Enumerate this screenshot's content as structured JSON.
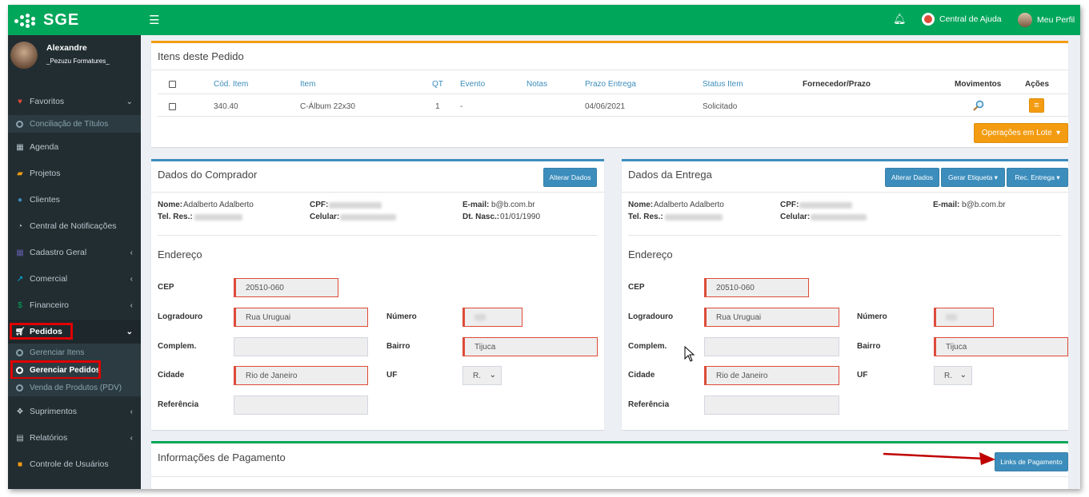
{
  "app": {
    "logo_text": "SGE"
  },
  "topbar": {
    "help_label": "Central de Ajuda",
    "profile_label": "Meu Perfil"
  },
  "user": {
    "name": "Alexandre",
    "org": "_Pezuzu Formatures_"
  },
  "sidebar": {
    "items": [
      {
        "label": "Favoritos",
        "icon": "heart-icon"
      },
      {
        "label": "Conciliação de Títulos",
        "icon": "circle-icon"
      },
      {
        "label": "Agenda",
        "icon": "calendar-icon"
      },
      {
        "label": "Projetos",
        "icon": "folder-icon"
      },
      {
        "label": "Clientes",
        "icon": "user-icon"
      },
      {
        "label": "Central de Notificações",
        "icon": "rss-icon"
      },
      {
        "label": "Cadastro Geral",
        "icon": "grid-icon"
      },
      {
        "label": "Comercial",
        "icon": "chart-icon"
      },
      {
        "label": "Financeiro",
        "icon": "dollar-icon"
      },
      {
        "label": "Pedidos",
        "icon": "cart-icon"
      },
      {
        "label": "Gerenciar Itens",
        "icon": "circle-icon"
      },
      {
        "label": "Gerenciar Pedidos",
        "icon": "circle-icon"
      },
      {
        "label": "Venda de Produtos (PDV)",
        "icon": "circle-icon"
      },
      {
        "label": "Suprimentos",
        "icon": "cubes-icon"
      },
      {
        "label": "Relatórios",
        "icon": "file-icon"
      },
      {
        "label": "Controle de Usuários",
        "icon": "lock-icon"
      }
    ]
  },
  "items_box": {
    "title": "Itens deste Pedido",
    "columns": [
      "Cód. Item",
      "Item",
      "QT",
      "Evento",
      "Notas",
      "Prazo Entrega",
      "Status Item",
      "Fornecedor/Prazo",
      "Movimentos",
      "Ações"
    ],
    "row": {
      "code": "340.40",
      "item": "C-Álbum 22x30",
      "qt": "1",
      "evento": "-",
      "notas": "",
      "prazo": "04/06/2021",
      "status": "Solicitado",
      "fornecedor": ""
    },
    "bulk_button": "Operações em Lote"
  },
  "buyer": {
    "title": "Dados do Comprador",
    "edit_button": "Alterar Dados",
    "nome_label": "Nome:",
    "nome": "Adalberto Adalberto",
    "cpf_label": "CPF:",
    "email_label": "E-mail:",
    "email": "b@b.com.br",
    "tel_label": "Tel. Res.:",
    "cel_label": "Celular:",
    "nasc_label": "Dt. Nasc.:",
    "nasc": "01/01/1990"
  },
  "delivery": {
    "title": "Dados da Entrega",
    "edit_button": "Alterar Dados",
    "label_button": "Gerar Etiqueta",
    "rec_button": "Rec. Entrega",
    "nome_label": "Nome:",
    "nome": "Adalberto Adalberto",
    "cpf_label": "CPF:",
    "email_label": "E-mail:",
    "email": "b@b.com.br",
    "tel_label": "Tel. Res.:",
    "cel_label": "Celular:"
  },
  "address": {
    "title": "Endereço",
    "cep_label": "CEP",
    "cep": "20510-060",
    "logradouro_label": "Logradouro",
    "logradouro": "Rua Uruguai",
    "numero_label": "Número",
    "complemento_label": "Complem.",
    "complemento": "",
    "bairro_label": "Bairro",
    "bairro": "Tijuca",
    "cidade_label": "Cidade",
    "cidade": "Rio de Janeiro",
    "uf_label": "UF",
    "uf": "R.",
    "referencia_label": "Referência",
    "referencia": ""
  },
  "payment": {
    "title": "Informações de Pagamento",
    "links_button": "Links de Pagamento"
  },
  "colors": {
    "topbar": "#00a65a",
    "sidebar": "#222d32",
    "accent_blue": "#3c8dbc",
    "accent_orange": "#f39c12",
    "highlight_red": "#e00000"
  }
}
